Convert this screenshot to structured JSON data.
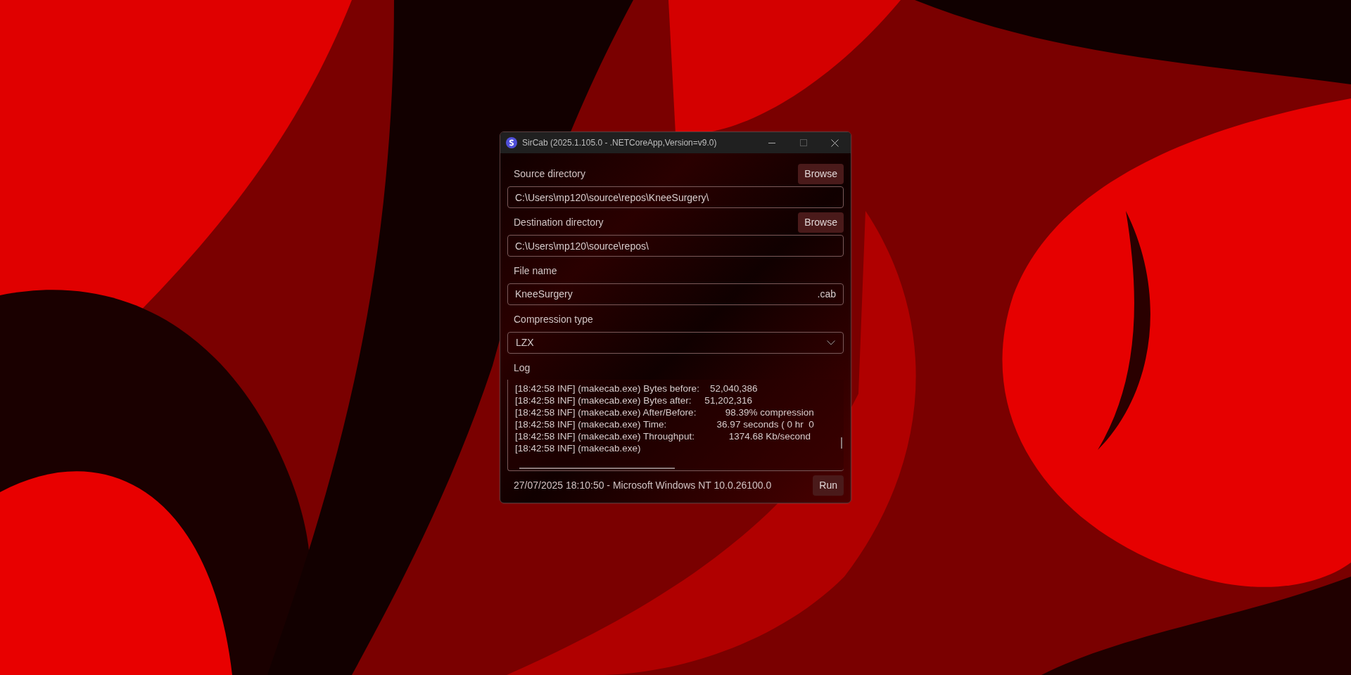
{
  "window": {
    "title": "SirCab (2025.1.105.0 - .NETCoreApp,Version=v9.0)"
  },
  "source": {
    "label": "Source directory",
    "button": "Browse",
    "value": "C:\\Users\\mp120\\source\\repos\\KneeSurgery\\"
  },
  "destination": {
    "label": "Destination directory",
    "button": "Browse",
    "value": "C:\\Users\\mp120\\source\\repos\\"
  },
  "file_name": {
    "label": "File name",
    "value": "KneeSurgery",
    "suffix": ".cab"
  },
  "compression": {
    "label": "Compression type",
    "value": "LZX"
  },
  "log": {
    "label": "Log",
    "lines": [
      "[18:42:58 INF] (makecab.exe) Bytes before:    52,040,386",
      "[18:42:58 INF] (makecab.exe) Bytes after:     51,202,316",
      "[18:42:58 INF] (makecab.exe) After/Before:           98.39% compression",
      "[18:42:58 INF] (makecab.exe) Time:                   36.97 seconds ( 0 hr  0",
      "[18:42:58 INF] (makecab.exe) Throughput:             1374.68 Kb/second",
      "[18:42:58 INF] (makecab.exe)"
    ]
  },
  "status": {
    "text": "27/07/2025 18:10:50 - Microsoft Windows NT 10.0.26100.0",
    "button": "Run"
  }
}
